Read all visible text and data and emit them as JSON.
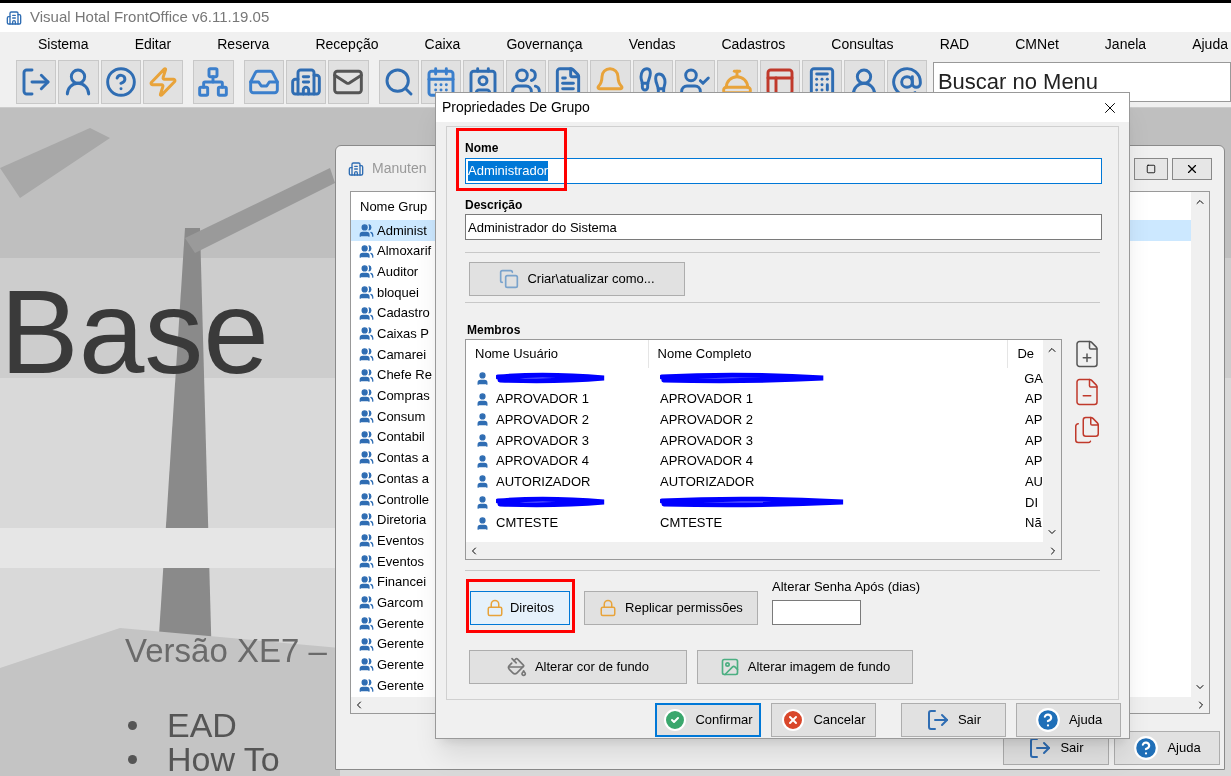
{
  "window": {
    "title": "Visual Hotal FrontOffice v6.11.19.05"
  },
  "menu": [
    "Sistema",
    "Editar",
    "Reserva",
    "Recepção",
    "Caixa",
    "Governança",
    "Vendas",
    "Cadastros",
    "Consultas",
    "RAD",
    "CMNet",
    "Janela",
    "Ajuda"
  ],
  "search": {
    "placeholder": "Buscar no Menu"
  },
  "background": {
    "title": "Base",
    "subtitle": "Versão XE7 –",
    "bullets": [
      "EAD",
      "How To"
    ]
  },
  "group_window": {
    "title": "Manuten",
    "column": "Nome Grup",
    "items": [
      {
        "label": "Administ",
        "selected": true
      },
      {
        "label": "Almoxarif",
        "selected": false
      },
      {
        "label": "Auditor",
        "selected": false
      },
      {
        "label": "bloquei",
        "selected": false
      },
      {
        "label": "Cadastro",
        "selected": false
      },
      {
        "label": "Caixas P",
        "selected": false
      },
      {
        "label": "Camarei",
        "selected": false
      },
      {
        "label": "Chefe Re",
        "selected": false
      },
      {
        "label": "Compras",
        "selected": false
      },
      {
        "label": "Consum",
        "selected": false
      },
      {
        "label": "Contabil",
        "selected": false
      },
      {
        "label": "Contas a",
        "selected": false
      },
      {
        "label": "Contas a",
        "selected": false
      },
      {
        "label": "Controlle",
        "selected": false
      },
      {
        "label": "Diretoria",
        "selected": false
      },
      {
        "label": "Eventos",
        "selected": false
      },
      {
        "label": "Eventos",
        "selected": false
      },
      {
        "label": "Financei",
        "selected": false
      },
      {
        "label": "Garcom",
        "selected": false
      },
      {
        "label": "Gerente",
        "selected": false
      },
      {
        "label": "Gerente",
        "selected": false
      },
      {
        "label": "Gerente",
        "selected": false
      },
      {
        "label": "Gerente",
        "selected": false
      }
    ],
    "buttons": [
      "Sair",
      "Ajuda"
    ]
  },
  "dialog": {
    "title": "Propriedades De Grupo",
    "name_label": "Nome",
    "name_value": "Administrador",
    "name_selected": true,
    "name_highlighted": true,
    "description_label": "Descrição",
    "description_value": "Administrador do Sistema",
    "copy_button": "Criar\\atualizar como...",
    "members_label": "Membros",
    "members": {
      "columns": [
        "Nome Usuário",
        "Nome Completo",
        "De"
      ],
      "rows": [
        {
          "redacted": true,
          "description": "GA"
        },
        {
          "redacted": false,
          "username": "APROVADOR 1",
          "fullname": "APROVADOR 1",
          "description": "AP"
        },
        {
          "redacted": false,
          "username": "APROVADOR 2",
          "fullname": "APROVADOR 2",
          "description": "AP"
        },
        {
          "redacted": false,
          "username": "APROVADOR 3",
          "fullname": "APROVADOR 3",
          "description": "AP"
        },
        {
          "redacted": false,
          "username": "APROVADOR 4",
          "fullname": "APROVADOR 4",
          "description": "AP"
        },
        {
          "redacted": false,
          "username": "AUTORIZADOR",
          "fullname": "AUTORIZADOR",
          "description": "AU"
        },
        {
          "redacted": true,
          "description": "DI"
        },
        {
          "redacted": false,
          "username": "CMTESTE",
          "fullname": "CMTESTE",
          "description": "Nã"
        }
      ]
    },
    "rights_button": {
      "label": "Direitos",
      "highlighted": true
    },
    "replicate_button": "Replicar permissões",
    "password_label": "Alterar Senha Após (dias)",
    "color_button": "Alterar cor de fundo",
    "image_button": "Alterar imagem de fundo",
    "footer": [
      {
        "kind": "confirm",
        "label": "Confirmar",
        "default": true
      },
      {
        "kind": "cancel",
        "label": "Cancelar",
        "default": false
      },
      {
        "kind": "exit",
        "label": "Sair",
        "default": false
      },
      {
        "kind": "help",
        "label": "Ajuda",
        "default": false
      }
    ]
  }
}
